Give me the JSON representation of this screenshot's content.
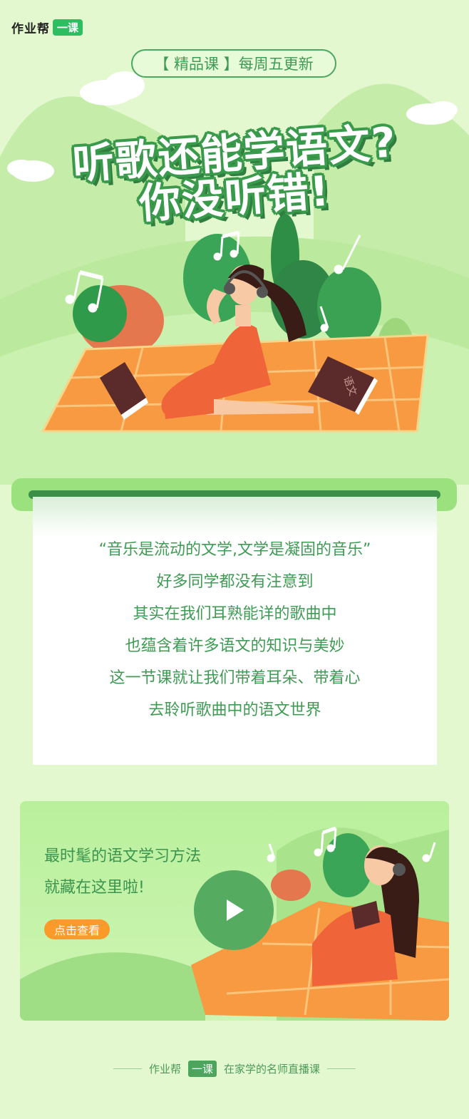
{
  "brand": {
    "name": "作业帮",
    "badge": "一课"
  },
  "tag": "【 精品课 】每周五更新",
  "title": {
    "line1": "听歌还能学语文?",
    "line2": "你没听错!"
  },
  "illustration": {
    "book_label": "语文"
  },
  "card": {
    "lines": [
      "“音乐是流动的文学,文学是凝固的音乐”",
      "好多同学都没有注意到",
      "其实在我们耳熟能详的歌曲中",
      "也蕴含着许多语文的知识与美妙",
      "这一节课就让我们带着耳朵、带着心",
      "去聆听歌曲中的语文世界"
    ]
  },
  "video": {
    "line1": "最时髦的语文学习方法",
    "line2": "就藏在这里啦!",
    "button": "点击查看"
  },
  "footer": {
    "brand": "作业帮",
    "badge": "一课",
    "slogan": "在家学的名师直播课"
  },
  "colors": {
    "accent_green": "#3b9a50",
    "bg": "#e3f8cf",
    "orange": "#f99a2b",
    "dress": "#f0643a"
  },
  "icons": [
    "play-icon",
    "music-note-icon",
    "book-icon",
    "headphones-icon"
  ]
}
